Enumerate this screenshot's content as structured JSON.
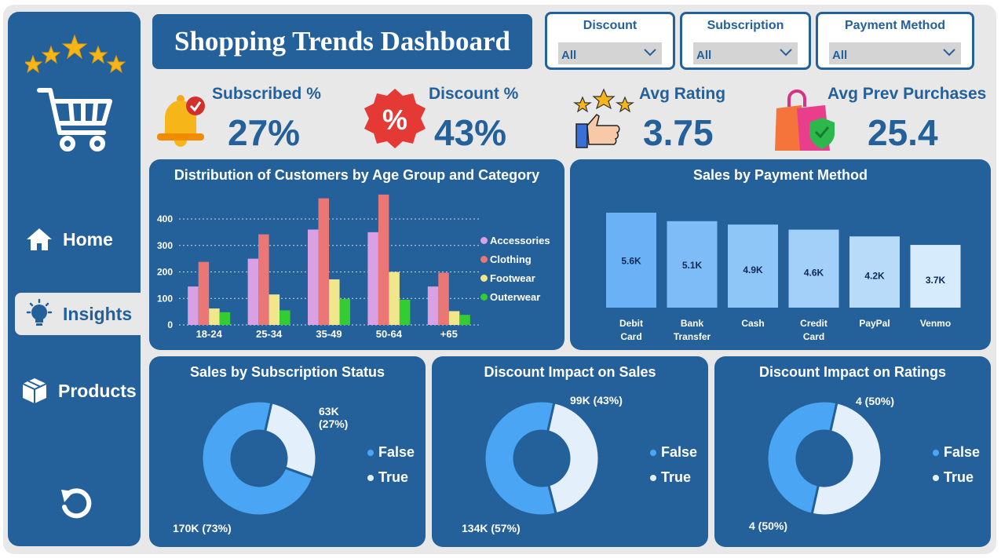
{
  "header": {
    "title": "Shopping Trends Dashboard"
  },
  "slicers": [
    {
      "label": "Discount",
      "value": "All"
    },
    {
      "label": "Subscription",
      "value": "All"
    },
    {
      "label": "Payment Method",
      "value": "All"
    }
  ],
  "sidebar": {
    "items": [
      {
        "label": "Home",
        "icon": "home-icon",
        "active": false
      },
      {
        "label": "Insights",
        "icon": "lightbulb-icon",
        "active": true
      },
      {
        "label": "Products",
        "icon": "box-icon",
        "active": false
      }
    ],
    "reset_icon": "refresh-icon"
  },
  "kpis": [
    {
      "label": "Subscribed %",
      "value": "27%",
      "icon": "bell-icon"
    },
    {
      "label": "Discount %",
      "value": "43%",
      "icon": "percent-badge-icon"
    },
    {
      "label": "Avg Rating",
      "value": "3.75",
      "icon": "thumbs-up-stars-icon"
    },
    {
      "label": "Avg Prev Purchases",
      "value": "25.4",
      "icon": "shopping-bag-icon"
    }
  ],
  "colors": {
    "brand": "#246099",
    "accessories": "#d9a0e4",
    "clothing": "#ea7775",
    "footwear": "#f0e68c",
    "outerwear": "#33cc33",
    "donut_false": "#4aa6f5",
    "donut_true": "#e3f0fc"
  },
  "chart_data": [
    {
      "type": "bar",
      "title": "Distribution of Customers by Age Group and Category",
      "categories": [
        "18-24",
        "25-34",
        "35-49",
        "50-64",
        "+65"
      ],
      "ylim": [
        0,
        400
      ],
      "yticks": [
        0,
        100,
        200,
        300,
        400
      ],
      "grid": true,
      "legend": "right",
      "series": [
        {
          "name": "Accessories",
          "values": [
            145,
            250,
            360,
            350,
            145
          ]
        },
        {
          "name": "Clothing",
          "values": [
            238,
            342,
            478,
            492,
            197
          ]
        },
        {
          "name": "Footwear",
          "values": [
            62,
            115,
            172,
            200,
            52
          ]
        },
        {
          "name": "Outerwear",
          "values": [
            48,
            55,
            98,
            95,
            38
          ]
        }
      ]
    },
    {
      "type": "bar",
      "title": "Sales by Payment Method",
      "categories": [
        "Debit Card",
        "Bank Transfer",
        "Cash",
        "Credit Card",
        "PayPal",
        "Venmo"
      ],
      "values": [
        5600,
        5100,
        4900,
        4600,
        4200,
        3700
      ],
      "labels": [
        "5.6K",
        "5.1K",
        "4.9K",
        "4.6K",
        "4.2K",
        "3.7K"
      ],
      "ylim": [
        0,
        5600
      ]
    },
    {
      "type": "pie",
      "title": "Sales by Subscription Status",
      "legend": [
        "False",
        "True"
      ],
      "values": [
        170,
        63
      ],
      "labels": [
        "170K (73%)",
        "63K (27%)"
      ]
    },
    {
      "type": "pie",
      "title": "Discount Impact on Sales",
      "legend": [
        "False",
        "True"
      ],
      "values": [
        134,
        99
      ],
      "labels": [
        "134K (57%)",
        "99K (43%)"
      ]
    },
    {
      "type": "pie",
      "title": "Discount Impact on Ratings",
      "legend": [
        "False",
        "True"
      ],
      "values": [
        4,
        4
      ],
      "labels": [
        "4 (50%)",
        "4 (50%)"
      ]
    }
  ]
}
